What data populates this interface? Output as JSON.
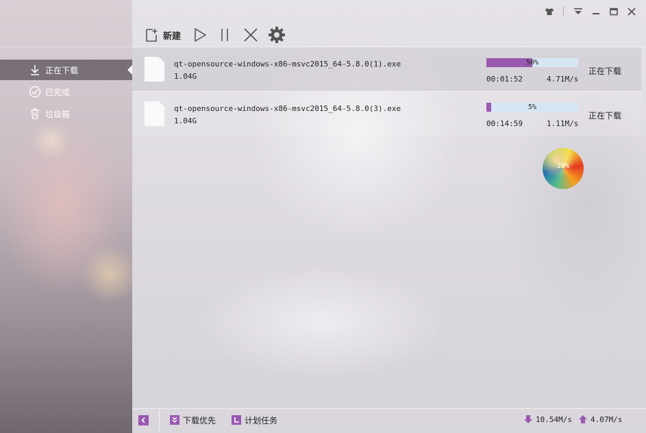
{
  "sidebar": {
    "items": [
      {
        "label": "正在下载",
        "icon": "download-icon",
        "active": true
      },
      {
        "label": "已完成",
        "icon": "check-circle-icon",
        "active": false
      },
      {
        "label": "垃圾箱",
        "icon": "trash-icon",
        "active": false
      }
    ]
  },
  "window": {
    "controls": [
      "skin-icon",
      "menu-icon",
      "minimize-icon",
      "maximize-icon",
      "close-icon"
    ]
  },
  "toolbar": {
    "new_label": "新建",
    "icons": [
      "new-file-icon",
      "play-icon",
      "pause-icon",
      "delete-icon",
      "settings-icon"
    ]
  },
  "downloads": [
    {
      "name": "qt-opensource-windows-x86-msvc2015_64-5.8.0(1).exe",
      "size": "1.04G",
      "progress": 0.5,
      "progress_label": "50%",
      "remaining": "00:01:52",
      "speed": "4.71M/s",
      "status": "正在下载"
    },
    {
      "name": "qt-opensource-windows-x86-msvc2015_64-5.8.0(3).exe",
      "size": "1.04G",
      "progress": 0.05,
      "progress_label": "5%",
      "remaining": "00:14:59",
      "speed": "1.11M/s",
      "status": "正在下载"
    }
  ],
  "float_ball": {
    "label": "28%",
    "progress": 0.28
  },
  "bottom_bar": {
    "priority_label": "下载优先",
    "schedule_label": "计划任务",
    "download_speed": "10.54M/s",
    "upload_speed": "4.07M/s"
  },
  "colors": {
    "accent": "#9a59b1",
    "progress_track": "#d6e6f4",
    "sidebar_active": "#5a525c"
  }
}
